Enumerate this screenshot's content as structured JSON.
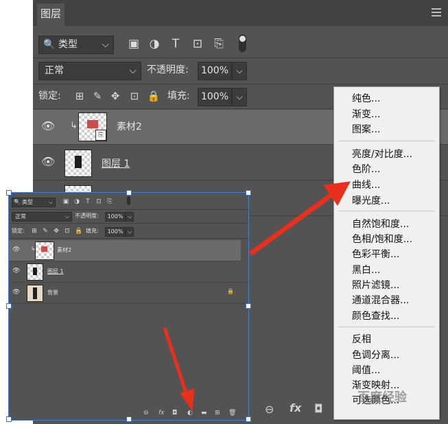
{
  "big_panel": {
    "tab_label": "图层",
    "filter": {
      "search_icon": "🔍",
      "label": "类型",
      "chevron": "⌵"
    },
    "filter_icons": [
      "image-filter-icon",
      "adjustment-filter-icon",
      "type-filter-icon",
      "shape-filter-icon",
      "smart-object-filter-icon"
    ],
    "filter_glyphs": [
      "▣",
      "◑",
      "T",
      "⊡",
      "⎘"
    ],
    "blend_mode": "正常",
    "opacity_label": "不透明度:",
    "opacity_value": "100%",
    "lock_label": "锁定:",
    "lock_glyphs": [
      "⊞",
      "✎",
      "✥",
      "⊡",
      "🔒"
    ],
    "fill_label": "填充:",
    "fill_value": "100%",
    "dropdown_glyph": "⌵",
    "layers": [
      {
        "name": "素材2",
        "visible_glyph": "👁",
        "clip_glyph": "↳"
      },
      {
        "name": "图层 1",
        "visible_glyph": "👁"
      },
      {
        "name": "",
        "visible_glyph": "👁"
      }
    ],
    "footer_glyphs": [
      "⊖",
      "fx",
      "◘"
    ]
  },
  "context_menu": {
    "groups": [
      [
        "纯色...",
        "渐变...",
        "图案..."
      ],
      [
        "亮度/对比度...",
        "色阶...",
        "曲线...",
        "曝光度..."
      ],
      [
        "自然饱和度...",
        "色相/饱和度...",
        "色彩平衡...",
        "黑白...",
        "照片滤镜...",
        "通道混合器...",
        "颜色查找..."
      ],
      [
        "反相",
        "色调分离...",
        "阈值...",
        "渐变映射...",
        "可选颜色..."
      ]
    ]
  },
  "small_panel": {
    "filter_label": "类型",
    "blend_mode": "正常",
    "opacity_label": "不透明度:",
    "opacity_value": "100%",
    "lock_label": "锁定:",
    "fill_label": "填充:",
    "fill_value": "100%",
    "layers": [
      {
        "name": "素材2"
      },
      {
        "name": "图层 1"
      },
      {
        "name": "背景",
        "lock_glyph": "🔒"
      }
    ],
    "footer_glyphs": [
      "⊖",
      "fx",
      "◘",
      "◐",
      "▬",
      "⊞",
      "🗑"
    ]
  },
  "watermark": "百度经验",
  "colors": {
    "panel_bg": "#535353",
    "menu_bg": "#f0f0f0",
    "arrow_red": "#e8301c",
    "selection_blue": "#4a7fd0"
  }
}
